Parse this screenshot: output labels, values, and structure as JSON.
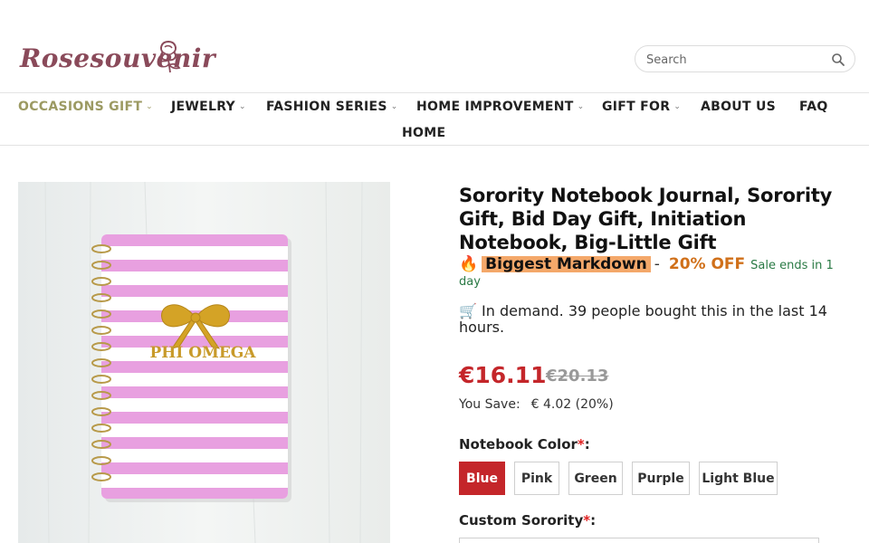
{
  "brand": {
    "logo_text": "Rosesouvenir"
  },
  "search": {
    "placeholder": "Search"
  },
  "nav": {
    "items": [
      {
        "label": "OCCASIONS GIFT",
        "has_dropdown": true,
        "active": true
      },
      {
        "label": "JEWELRY",
        "has_dropdown": true
      },
      {
        "label": "FASHION SERIES",
        "has_dropdown": true
      },
      {
        "label": "HOME IMPROVEMENT",
        "has_dropdown": true
      },
      {
        "label": "GIFT FOR",
        "has_dropdown": true
      },
      {
        "label": "ABOUT US",
        "has_dropdown": false
      },
      {
        "label": "FAQ",
        "has_dropdown": false
      },
      {
        "label": "HOME",
        "has_dropdown": false
      }
    ],
    "chevron": "⌄"
  },
  "product": {
    "title": "Sorority Notebook Journal, Sorority Gift, Bid Day Gift, Initiation Notebook, Big-Little Gift",
    "image_text": "PHI OMEGA",
    "promo": {
      "icon": "fire-icon",
      "icon_glyph": "🔥",
      "badge": "Biggest Markdown",
      "dash": "-",
      "discount": "20% OFF",
      "sale_ends": "Sale ends in 1 day"
    },
    "demand": {
      "icon": "cart-icon",
      "icon_glyph": "🛒",
      "text": "In demand. 39 people bought this in the last 14 hours."
    },
    "price": "€16.11",
    "old_price": "€20.13",
    "you_save_label": "You Save:",
    "you_save_amount": "€ 4.02 (20%)",
    "color_label": "Notebook Color",
    "required_mark": "*",
    "colon": ":",
    "colors": [
      "Blue",
      "Pink",
      "Green",
      "Purple",
      "Light Blue"
    ],
    "selected_color": "Blue",
    "custom_label": "Custom Sorority",
    "custom_value": ""
  },
  "colors": {
    "accent_red": "#c4262a",
    "nav_active": "#9c9a63",
    "badge_bg": "#f4a86a",
    "discount_orange": "#d0701a",
    "sale_green": "#2a7a45",
    "notebook_pink": "#e8a0e0",
    "bow_gold": "#d4a326"
  }
}
